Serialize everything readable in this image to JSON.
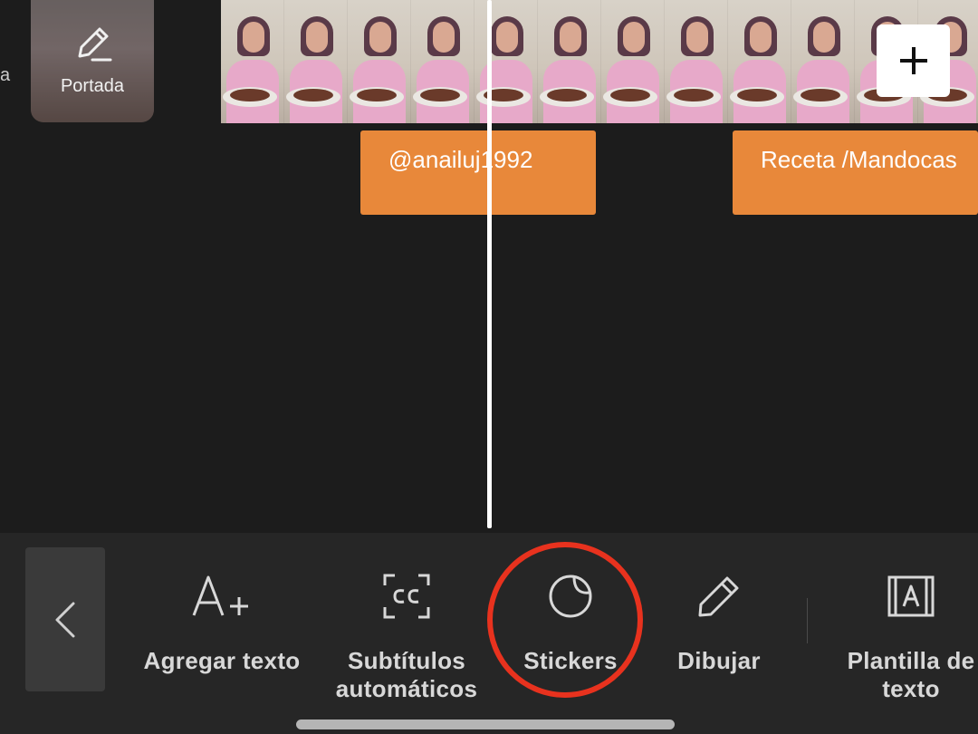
{
  "edge_char": "a",
  "cover": {
    "label": "Portada",
    "icon": "pencil-line-icon"
  },
  "film_strip": {
    "frame_count": 12,
    "add_button_icon": "plus-icon"
  },
  "text_clips": [
    {
      "text": "@anailuj1992"
    },
    {
      "text": "Receta /Mandocas"
    }
  ],
  "toolbar": {
    "back_icon": "chevron-left-icon",
    "tools": [
      {
        "label_line1": "Agregar texto",
        "label_line2": "",
        "icon": "text-add-icon"
      },
      {
        "label_line1": "Subtítulos",
        "label_line2": "automáticos",
        "icon": "closed-captions-icon"
      },
      {
        "label_line1": "Stickers",
        "label_line2": "",
        "icon": "sticker-icon"
      },
      {
        "label_line1": "Dibujar",
        "label_line2": "",
        "icon": "pencil-icon"
      },
      {
        "label_line1": "Plantilla de",
        "label_line2": "texto",
        "icon": "text-template-icon"
      }
    ]
  },
  "colors": {
    "background": "#1c1c1c",
    "toolbar": "#262626",
    "clip": "#e8883a",
    "highlight": "#e8321e"
  }
}
